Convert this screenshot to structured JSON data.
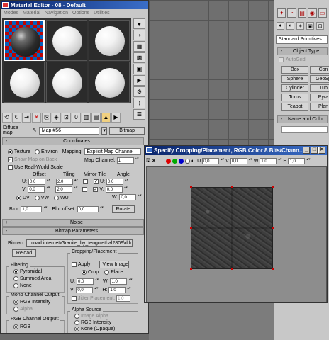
{
  "material_editor": {
    "title": "Material Editor - 08 - Default",
    "menu": [
      "Modes",
      "Material",
      "Navigation",
      "Options",
      "Utilities"
    ],
    "diffuse_label": "Diffuse map:",
    "map_name": "Map #56",
    "map_type": "Bitmap",
    "coordinates": {
      "header": "Coordinates",
      "texture": "Texture",
      "environ": "Environ",
      "mapping_label": "Mapping:",
      "mapping_value": "Explicit Map Channel",
      "show_map_on_back": "Show Map on Back",
      "map_channel_label": "Map Channel:",
      "map_channel_value": "1",
      "real_world": "Use Real-World Scale",
      "offset": "Offset",
      "tiling": "Tiling",
      "mirror_tile": "Mirror Tile",
      "angle": "Angle",
      "u_offset": "0,0",
      "v_offset": "0,0",
      "u_tiling": "2,0",
      "v_tiling": "2,0",
      "u_angle": "0,0",
      "v_angle": "0,0",
      "w_angle": "0,0",
      "u": "U:",
      "v": "V:",
      "w": "W:",
      "uv": "UV",
      "vw": "VW",
      "wu": "WU",
      "blur_label": "Blur:",
      "blur_value": "1,0",
      "blur_offset_label": "Blur offset:",
      "blur_offset_value": "0,0",
      "rotate": "Rotate"
    },
    "noise_header": "Noise",
    "bitmap_params": {
      "header": "Bitmap Parameters",
      "bitmap_label": "Bitmap:",
      "bitmap_path": "nload internet\\Granite_by_tengolethal2809\\difuse.jpg",
      "reload": "Reload",
      "cropping_label": "Cropping/Placement",
      "apply": "Apply",
      "view_image": "View Image",
      "crop": "Crop",
      "place": "Place",
      "filtering_label": "Filtering",
      "pyramidal": "Pyramidal",
      "summed_area": "Summed Area",
      "none": "None",
      "u_label": "U:",
      "u_value": "0,0",
      "v_label": "V:",
      "v_value": "0,0",
      "w_label": "W:",
      "w_value": "1,0",
      "h_label": "H:",
      "h_value": "1,0",
      "jitter": "Jitter Placement:",
      "jitter_value": "1,0",
      "mono_label": "Mono Channel Output:",
      "rgb_intensity": "RGB Intensity",
      "alpha": "Alpha",
      "rgb_channel_label": "RGB Channel Output:",
      "rgb": "RGB",
      "alpha_source_label": "Alpha Source",
      "image_alpha": "Image Alpha",
      "alpha_rgb_intensity": "RGB Intensity",
      "none_opaque": "None (Opaque)"
    }
  },
  "crop_window": {
    "title": "Specify Cropping/Placement, RGB Color 8 Bits/Chann...",
    "u_label": "U",
    "u_value": "0,0",
    "v_label": "V",
    "v_value": "0,0",
    "w_label": "W",
    "w_value": "1,0",
    "h_label": "H",
    "h_value": "1,0"
  },
  "command_panel": {
    "primitives": "Standard Primitives",
    "object_type": "Object Type",
    "autogrid": "AutoGrid",
    "objects": [
      "Box",
      "Con",
      "Sphere",
      "GeoSp",
      "Cylinder",
      "Tub",
      "Torus",
      "Pyra",
      "Teapot",
      "Plan"
    ],
    "name_and_color": "Name and Color"
  },
  "colors": {
    "title_bar": "#0a246a",
    "panel": "#c8c8c8"
  }
}
